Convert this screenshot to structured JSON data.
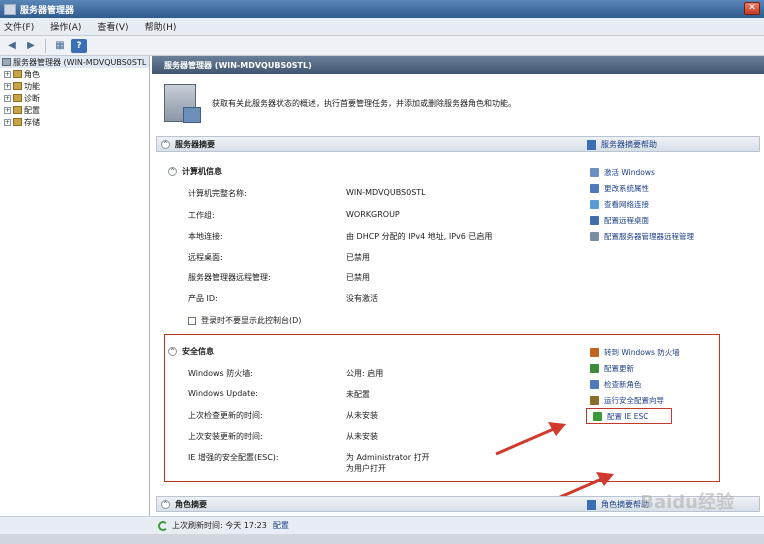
{
  "window": {
    "title": "服务器管理器"
  },
  "menu": [
    "文件(F)",
    "操作(A)",
    "查看(V)",
    "帮助(H)"
  ],
  "tree": {
    "root": "服务器管理器 (WIN-MDVQUBS0STL",
    "children": [
      "角色",
      "功能",
      "诊断",
      "配置",
      "存储"
    ]
  },
  "header": {
    "title": "服务器管理器 (WIN-MDVQUBS0STL)"
  },
  "intro": "获取有关此服务器状态的概述，执行首要管理任务，并添加或删除服务器角色和功能。",
  "summary": {
    "title": "服务器摘要",
    "help": "服务器摘要帮助",
    "computer_info": {
      "title": "计算机信息",
      "rows": [
        {
          "label": "计算机完整名称:",
          "value": "WIN-MDVQUBS0STL"
        },
        {
          "label": "工作组:",
          "value": "WORKGROUP"
        },
        {
          "label": "本地连接:",
          "value": "由 DHCP 分配的 IPv4 地址, IPv6 已启用"
        },
        {
          "label": "远程桌面:",
          "value": "已禁用"
        },
        {
          "label": "服务器管理器远程管理:",
          "value": "已禁用"
        },
        {
          "label": "产品 ID:",
          "value": "没有激活"
        }
      ],
      "checkbox": "登录时不要显示此控制台(D)",
      "actions": [
        "激活 Windows",
        "更改系统属性",
        "查看网络连接",
        "配置远程桌面",
        "配置服务器管理器远程管理"
      ]
    },
    "security_info": {
      "title": "安全信息",
      "rows": [
        {
          "label": "Windows 防火墙:",
          "value": "公用: 启用"
        },
        {
          "label": "Windows Update:",
          "value": "未配置"
        },
        {
          "label": "上次检查更新的时间:",
          "value": "从未安装"
        },
        {
          "label": "上次安装更新的时间:",
          "value": "从未安装"
        },
        {
          "label": "IE 增强的安全配置(ESC):",
          "value": "为 Administrator 打开",
          "value2": "为用户打开"
        }
      ],
      "actions": [
        "转到 Windows 防火墙",
        "配置更新",
        "检查新角色",
        "运行安全配置向导",
        "配置 IE ESC"
      ]
    }
  },
  "roles": {
    "title": "角色摘要",
    "help": "角色摘要帮助"
  },
  "status": {
    "refresh_text": "上次刷新时间: 今天 17:23",
    "link": "配置"
  },
  "watermark": "Baidu经验",
  "colors": {
    "accent_red": "#c0392b",
    "link": "#1c3f8a"
  }
}
